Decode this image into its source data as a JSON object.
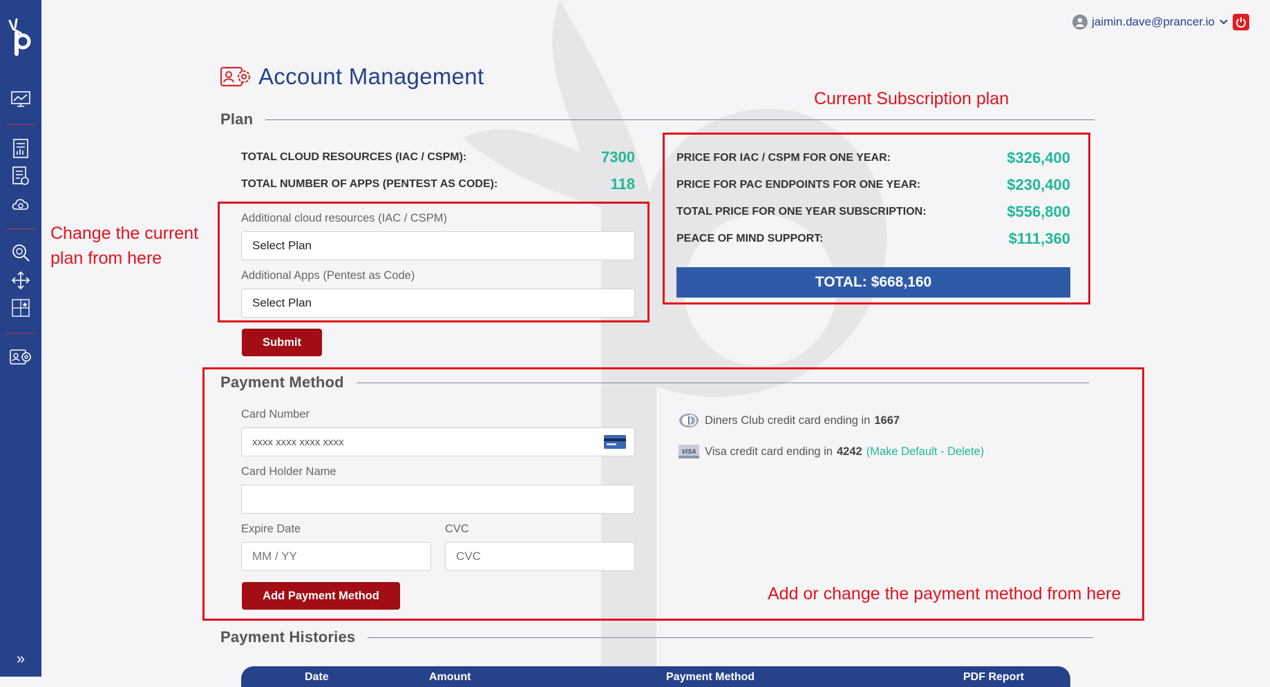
{
  "user": {
    "email": "jaimin.dave@prancer.io"
  },
  "page": {
    "title": "Account Management"
  },
  "plan": {
    "section_title": "Plan",
    "stats": [
      {
        "label": "TOTAL CLOUD RESOURCES (IAC / CSPM):",
        "value": "7300"
      },
      {
        "label": "TOTAL NUMBER OF APPS (PENTEST AS CODE):",
        "value": "118"
      }
    ],
    "additional_cloud_label": "Additional cloud resources (IAC / CSPM)",
    "additional_cloud_value": "Select Plan",
    "additional_apps_label": "Additional Apps (Pentest as Code)",
    "additional_apps_value": "Select Plan",
    "submit_label": "Submit"
  },
  "subscription": {
    "prices": [
      {
        "label": "PRICE FOR IAC / CSPM FOR ONE YEAR:",
        "value": "$326,400"
      },
      {
        "label": "PRICE FOR PAC ENDPOINTS FOR ONE YEAR:",
        "value": "$230,400"
      },
      {
        "label": "TOTAL PRICE FOR ONE YEAR SUBSCRIPTION:",
        "value": "$556,800"
      },
      {
        "label": "PEACE OF MIND SUPPORT:",
        "value": "$111,360"
      }
    ],
    "total": "TOTAL: $668,160"
  },
  "payment": {
    "section_title": "Payment Method",
    "card_number_label": "Card Number",
    "card_number_placeholder": "xxxx xxxx xxxx xxxx",
    "holder_label": "Card Holder Name",
    "holder_value": "",
    "expire_label": "Expire Date",
    "expire_placeholder": "MM / YY",
    "cvc_label": "CVC",
    "cvc_placeholder": "CVC",
    "add_button": "Add Payment Method",
    "cards": [
      {
        "text": "Diners Club credit card ending in",
        "last4": "1667",
        "icon": "diners-club-icon"
      },
      {
        "text": "Visa credit card ending in",
        "last4": "4242",
        "icon": "visa-icon",
        "make_default": "Make Default",
        "delete": "Delete"
      }
    ]
  },
  "histories": {
    "section_title": "Payment Histories",
    "columns": [
      "Date",
      "Amount",
      "Payment Method",
      "PDF Report"
    ]
  },
  "annotations": {
    "current_plan": "Current Subscription plan",
    "change_plan_line1": "Change the current",
    "change_plan_line2": "plan from here",
    "payment_note": "Add or change the payment method from here"
  },
  "colors": {
    "sidebar": "#26428b",
    "accent": "#1fb89a",
    "button": "#a30d14",
    "annotation": "#e3121b",
    "total_bar": "#2f5aa8"
  }
}
